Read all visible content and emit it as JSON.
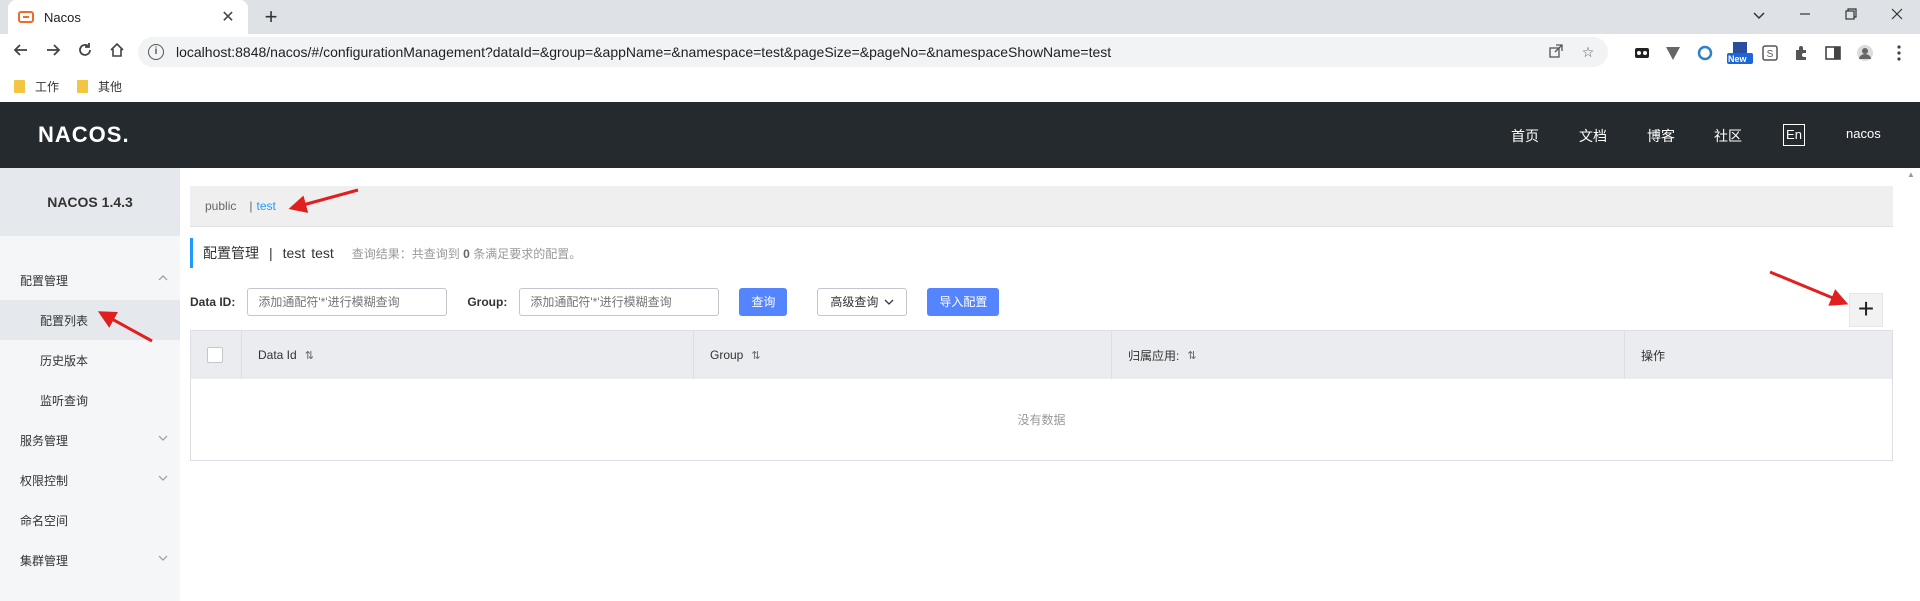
{
  "browser": {
    "tab_title": "Nacos",
    "tab_close": "✕",
    "new_tab": "+",
    "url": "localhost:8848/nacos/#/configurationManagement?dataId=&group=&appName=&namespace=test&pageSize=&pageNo=&namespaceShowName=test",
    "bookmarks": [
      "工作",
      "其他"
    ],
    "extensions": [
      "new-badge-extension",
      "s-extension",
      "puzzle-icon",
      "sidepanel-icon",
      "profile-icon"
    ],
    "new_badge": "New"
  },
  "header": {
    "logo": "NACOS.",
    "nav": [
      "首页",
      "文档",
      "博客",
      "社区"
    ],
    "lang": "En",
    "user": "nacos",
    "bg_color": "#252a2f"
  },
  "sidebar": {
    "version": "NACOS 1.4.3",
    "items": [
      {
        "label": "配置管理",
        "chevron": "up"
      },
      {
        "label": "配置列表",
        "active": true
      },
      {
        "label": "历史版本"
      },
      {
        "label": "监听查询"
      },
      {
        "label": "服务管理",
        "chevron": "down"
      },
      {
        "label": "权限控制",
        "chevron": "down"
      },
      {
        "label": "命名空间"
      },
      {
        "label": "集群管理",
        "chevron": "down"
      }
    ]
  },
  "namespace": {
    "items": [
      "public",
      "test"
    ],
    "separator": "|",
    "current": "test",
    "accent": "#209bfa"
  },
  "page": {
    "title": "配置管理",
    "sep": "|",
    "ns_name": "test",
    "ns_id": "test",
    "result_prefix": "查询结果：共查询到",
    "result_count": "0",
    "result_suffix": "条满足要求的配置。"
  },
  "filters": {
    "dataid_label": "Data ID:",
    "dataid_placeholder": "添加通配符'*'进行模糊查询",
    "group_label": "Group:",
    "group_placeholder": "添加通配符'*'进行模糊查询",
    "query_btn": "查询",
    "advanced_btn": "高级查询",
    "import_btn": "导入配置",
    "add_btn": "+"
  },
  "table": {
    "columns": [
      "Data Id",
      "Group",
      "归属应用:",
      "操作"
    ],
    "empty_text": "没有数据"
  }
}
